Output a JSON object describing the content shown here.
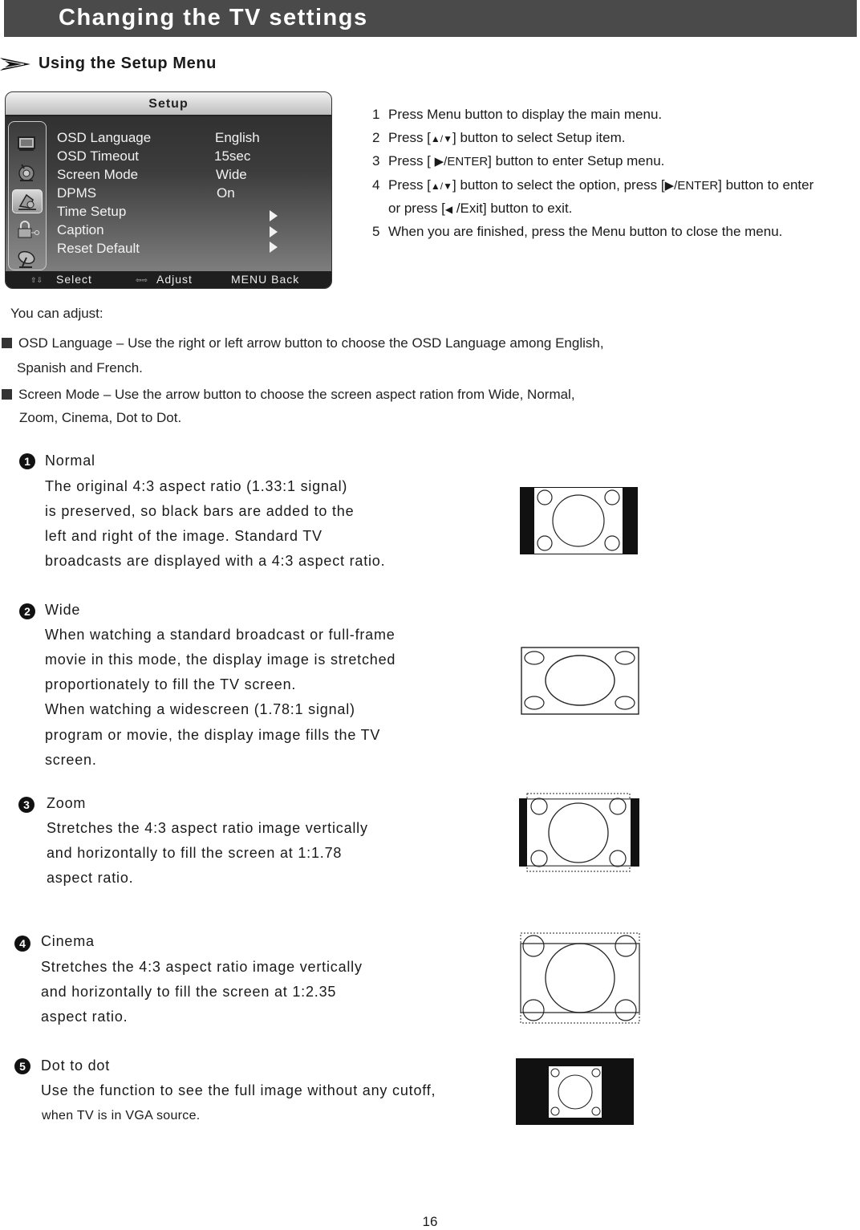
{
  "page_title": "Changing the TV settings",
  "section_title": "Using the Setup Menu",
  "osd_menu": {
    "title": "Setup",
    "side_icons": [
      "picture-icon",
      "audio-icon",
      "setup-icon",
      "lock-icon",
      "channel-dish-icon"
    ],
    "selected_icon_index": 2,
    "items": [
      {
        "label": "OSD  Language",
        "value": "English",
        "has_submenu": false
      },
      {
        "label": "OSD Timeout",
        "value": "15sec",
        "has_submenu": false
      },
      {
        "label": "Screen  Mode",
        "value": "Wide",
        "has_submenu": false
      },
      {
        "label": "DPMS",
        "value": "On",
        "has_submenu": false
      },
      {
        "label": "Time Setup",
        "value": "",
        "has_submenu": true
      },
      {
        "label": "Caption",
        "value": "",
        "has_submenu": true
      },
      {
        "label": "Reset Default",
        "value": "",
        "has_submenu": true
      }
    ],
    "footer": {
      "select_glyph": "⇧⇩",
      "select_label": "Select",
      "adjust_glyph": "⇦⇨",
      "adjust_label": "Adjust",
      "back_label": "MENU  Back"
    }
  },
  "steps": [
    {
      "num": "1",
      "parts": [
        "Press Menu button to display the main menu."
      ]
    },
    {
      "num": "2",
      "parts": [
        "Press [",
        "▲/▼",
        "] button to select Setup item."
      ]
    },
    {
      "num": "3",
      "parts": [
        "Press [ ",
        "▶/ENTER",
        "] button to enter Setup menu."
      ]
    },
    {
      "num": "4",
      "parts": [
        "Press [",
        "▲/▼",
        "] button to select the option, press [",
        "▶/ENTER",
        "] button to enter"
      ]
    },
    {
      "num": "",
      "parts": [
        "or press [",
        "◀",
        " /Exit] button to exit."
      ]
    },
    {
      "num": "5",
      "parts": [
        "When you are finished, press the Menu button to close the menu."
      ]
    }
  ],
  "adjust_intro": "You can adjust:",
  "adjust_items": [
    {
      "lines": [
        "OSD Language – Use the right or left arrow button to choose the OSD Language among English,",
        "Spanish and French."
      ]
    },
    {
      "lines": [
        "Screen Mode –  Use the arrow button to choose the screen aspect ration from Wide,  Normal,",
        "Zoom,  Cinema,  Dot  to  Dot."
      ]
    }
  ],
  "modes": [
    {
      "num": "1",
      "title": "Normal",
      "lines": [
        "The original 4:3 aspect ratio (1.33:1 signal)",
        "is preserved, so black bars are added to the",
        "left and right of the image. Standard TV",
        "broadcasts are displayed with a 4:3 aspect ratio."
      ]
    },
    {
      "num": "2",
      "title": "Wide",
      "lines": [
        "When watching a standard broadcast or full-frame",
        "movie in this mode, the display image is stretched",
        "proportionately to fill the TV screen.",
        "When watching a widescreen (1.78:1 signal)",
        "program or movie, the display image fills the TV",
        "screen."
      ]
    },
    {
      "num": "3",
      "title": "Zoom",
      "lines": [
        "Stretches the 4:3 aspect ratio image vertically",
        "and horizontally to fill the screen at 1:1.78",
        "aspect ratio."
      ]
    },
    {
      "num": "4",
      "title": "Cinema",
      "lines": [
        "Stretches the 4:3 aspect ratio image vertically",
        "and horizontally to fill the screen at 1:2.35",
        "aspect ratio."
      ]
    },
    {
      "num": "5",
      "title": "Dot  to  dot",
      "lines": [
        "Use the function to see the full image without any cutoff,",
        "when TV is in VGA source."
      ]
    }
  ],
  "page_number": "16"
}
